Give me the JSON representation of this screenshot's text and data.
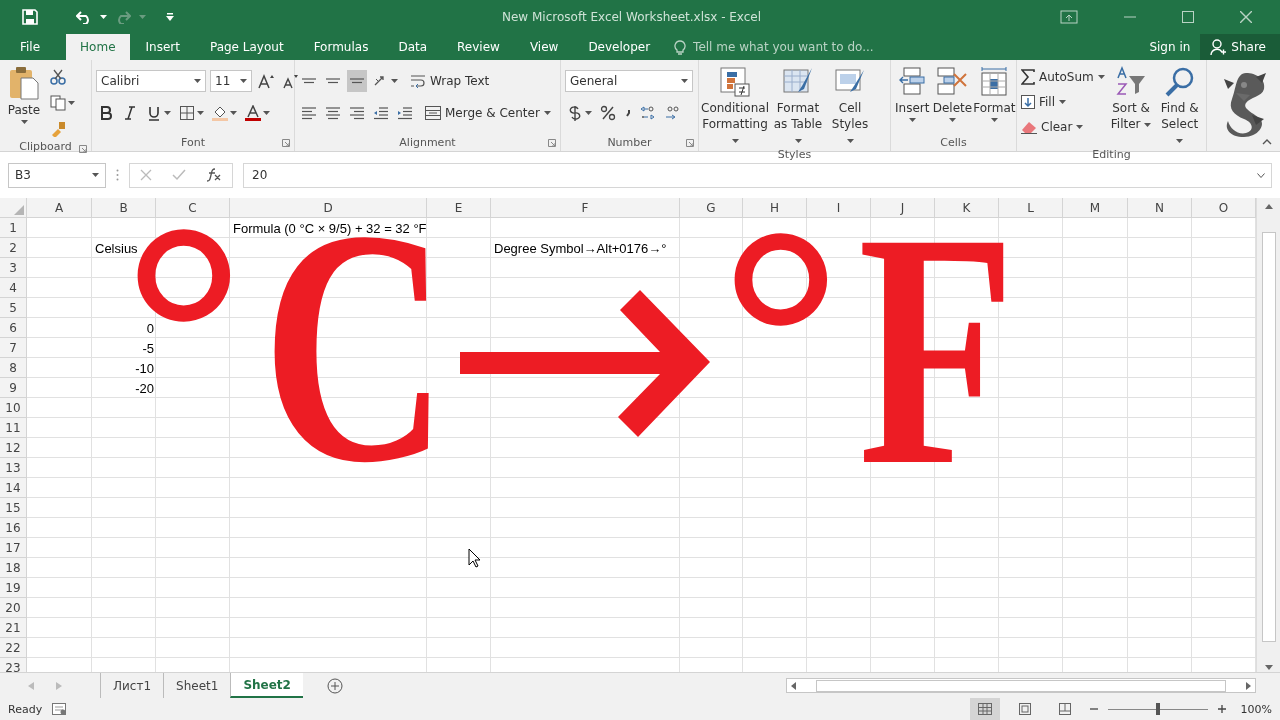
{
  "window": {
    "title": "New Microsoft Excel Worksheet.xlsx - Excel"
  },
  "tabs": [
    {
      "label": "File",
      "selected": false
    },
    {
      "label": "Home",
      "selected": true
    },
    {
      "label": "Insert",
      "selected": false
    },
    {
      "label": "Page Layout",
      "selected": false
    },
    {
      "label": "Formulas",
      "selected": false
    },
    {
      "label": "Data",
      "selected": false
    },
    {
      "label": "Review",
      "selected": false
    },
    {
      "label": "View",
      "selected": false
    },
    {
      "label": "Developer",
      "selected": false
    }
  ],
  "tell_me": {
    "placeholder": "Tell me what you want to do..."
  },
  "account": {
    "sign_in": "Sign in",
    "share": "Share"
  },
  "ribbon": {
    "clipboard": {
      "paste": "Paste",
      "label": "Clipboard"
    },
    "font": {
      "name": "Calibri",
      "size": "11",
      "label": "Font"
    },
    "alignment": {
      "wrap_text": "Wrap Text",
      "merge": "Merge & Center",
      "label": "Alignment"
    },
    "number": {
      "format": "General",
      "label": "Number"
    },
    "styles": {
      "buttons": [
        "Conditional Formatting",
        "Format as Table",
        "Cell Styles"
      ],
      "label": "Styles"
    },
    "cells": {
      "buttons": [
        "Insert",
        "Delete",
        "Format"
      ],
      "label": "Cells"
    },
    "editing": {
      "autosum": "AutoSum",
      "fill": "Fill",
      "clear": "Clear",
      "sort": "Sort & Filter",
      "find": "Find & Select",
      "label": "Editing"
    }
  },
  "formula_bar": {
    "name_box": "B3",
    "value": "20"
  },
  "grid": {
    "columns": [
      "A",
      "B",
      "C",
      "D",
      "E",
      "F",
      "G",
      "H",
      "I",
      "J",
      "K",
      "L",
      "M",
      "N",
      "O"
    ],
    "rows": [
      {
        "label": "1",
        "cells": {
          "D": {
            "text": "Formula (0 °C × 9/5) + 32 = 32 °F",
            "kind": "text"
          }
        }
      },
      {
        "label": "2",
        "cells": {
          "B": {
            "text": "Celsius",
            "kind": "text"
          },
          "F": {
            "text": "Degree Symbol→Alt+0176→°",
            "kind": "text"
          }
        }
      },
      {
        "label": "3",
        "cells": {}
      },
      {
        "label": "4",
        "cells": {}
      },
      {
        "label": "5",
        "cells": {}
      },
      {
        "label": "6",
        "cells": {
          "B": {
            "text": "0",
            "kind": "number"
          }
        }
      },
      {
        "label": "7",
        "cells": {
          "B": {
            "text": "-5",
            "kind": "number"
          }
        }
      },
      {
        "label": "8",
        "cells": {
          "B": {
            "text": "-10",
            "kind": "number"
          }
        }
      },
      {
        "label": "9",
        "cells": {
          "B": {
            "text": "-20",
            "kind": "number"
          }
        }
      },
      {
        "label": "10",
        "cells": {}
      },
      {
        "label": "11",
        "cells": {}
      },
      {
        "label": "12",
        "cells": {}
      },
      {
        "label": "13",
        "cells": {}
      },
      {
        "label": "14",
        "cells": {}
      },
      {
        "label": "15",
        "cells": {}
      },
      {
        "label": "16",
        "cells": {}
      },
      {
        "label": "17",
        "cells": {}
      },
      {
        "label": "18",
        "cells": {}
      },
      {
        "label": "19",
        "cells": {}
      },
      {
        "label": "20",
        "cells": {}
      },
      {
        "label": "21",
        "cells": {}
      },
      {
        "label": "22",
        "cells": {}
      },
      {
        "label": "23",
        "cells": {}
      }
    ]
  },
  "overlay": {
    "celsius_degree": "°",
    "celsius_letter": "C",
    "fahrenheit_degree": "°",
    "fahrenheit_letter": "F"
  },
  "sheets": [
    {
      "label": "Лист1",
      "selected": false
    },
    {
      "label": "Sheet1",
      "selected": false
    },
    {
      "label": "Sheet2",
      "selected": true
    }
  ],
  "status_bar": {
    "status": "Ready",
    "zoom": "100%",
    "zoom_slider": {
      "level": 0.5
    }
  }
}
